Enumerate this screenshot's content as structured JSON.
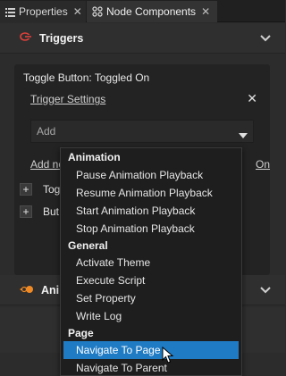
{
  "tabs": [
    {
      "label": "Properties",
      "icon": "properties-icon",
      "active": false
    },
    {
      "label": "Node Components",
      "icon": "node-components-icon",
      "active": true
    }
  ],
  "triggers_section": {
    "title": "Triggers",
    "icon": "trigger-icon"
  },
  "trigger_card": {
    "title": "Toggle Button: Toggled On",
    "settings_link": "Trigger Settings",
    "add_placeholder": "Add",
    "add_node_link": "Add no",
    "add_right_link": "On",
    "rows": [
      {
        "label": "Tog"
      },
      {
        "label": "But"
      }
    ]
  },
  "animations_section": {
    "title": "Ani",
    "icon": "animation-icon"
  },
  "dropdown": {
    "groups": [
      {
        "name": "Animation",
        "items": [
          "Pause Animation Playback",
          "Resume Animation Playback",
          "Start Animation Playback",
          "Stop Animation Playback"
        ]
      },
      {
        "name": "General",
        "items": [
          "Activate Theme",
          "Execute Script",
          "Set Property",
          "Write Log"
        ]
      },
      {
        "name": "Page",
        "items": [
          "Navigate To Page",
          "Navigate To Parent"
        ]
      }
    ],
    "selected": "Navigate To Page"
  },
  "colors": {
    "selection": "#1f7bc4",
    "trigger_icon": "#e0403a",
    "animation_icon": "#f08a24"
  }
}
